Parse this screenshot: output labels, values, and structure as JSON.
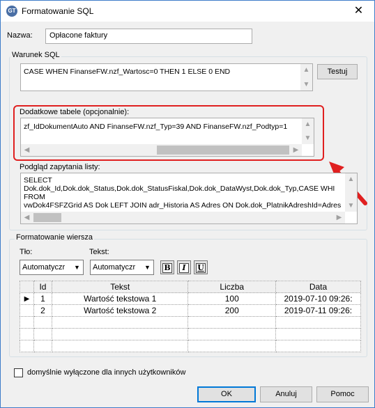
{
  "window": {
    "title": "Formatowanie SQL",
    "icon_text": "GT",
    "close_glyph": "✕"
  },
  "name_field": {
    "label": "Nazwa:",
    "value": "Opłacone faktury"
  },
  "sql_group": {
    "title": "Warunek SQL",
    "condition": "CASE WHEN FinanseFW.nzf_Wartosc=0 THEN 1 ELSE 0 END",
    "test_button": "Testuj",
    "extra_tables_label": "Dodatkowe tabele (opcjonalnie):",
    "extra_tables": "zf_IdDokumentAuto AND FinanseFW.nzf_Typ=39 AND FinanseFW.nzf_Podtyp=1",
    "preview_label": "Podgląd zapytania listy:",
    "preview_lines": [
      "SELECT",
      "Dok.dok_Id,Dok.dok_Status,Dok.dok_StatusFiskal,Dok.dok_DataWyst,Dok.dok_Typ,CASE WHI",
      "FROM",
      "vwDok4FSFZGrid AS Dok LEFT JOIN adr_Historia AS Adres ON Dok.dok_PlatnikAdreshId=Adres"
    ]
  },
  "row_format_group": {
    "title": "Formatowanie wiersza",
    "bg_label": "Tło:",
    "bg_value": "Automatyczr",
    "text_label": "Tekst:",
    "text_value": "Automatyczr",
    "bold": "B",
    "italic": "I",
    "underline": "U",
    "grid": {
      "columns": [
        "",
        "Id",
        "Tekst",
        "Liczba",
        "Data"
      ],
      "rows": [
        {
          "marker": "▶",
          "id": "1",
          "text": "Wartość tekstowa 1",
          "number": "100",
          "date": "2019-07-10 09:26:"
        },
        {
          "marker": "",
          "id": "2",
          "text": "Wartość tekstowa 2",
          "number": "200",
          "date": "2019-07-11 09:26:"
        }
      ]
    }
  },
  "default_off_checkbox": {
    "label": "domyślnie wyłączone dla innych użytkowników",
    "checked": false
  },
  "buttons": {
    "ok": "OK",
    "cancel": "Anuluj",
    "help": "Pomoc"
  },
  "colors": {
    "highlight": "#e02020",
    "arrow": "#e02020",
    "window_border": "#3d7cc9"
  }
}
